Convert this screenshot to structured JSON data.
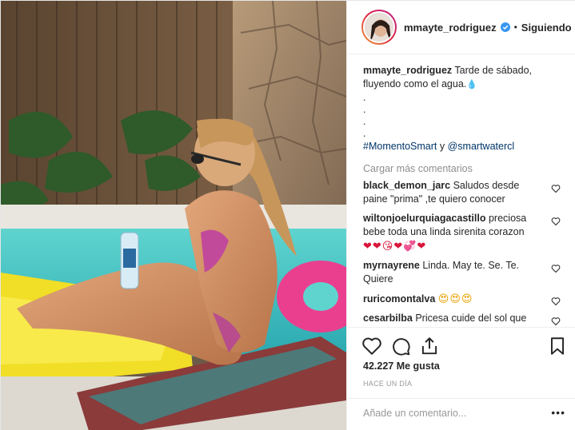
{
  "header": {
    "username": "mmayte_rodriguez",
    "separator": "•",
    "follow_label": "Siguiendo"
  },
  "caption": {
    "username": "mmayte_rodriguez",
    "text": "Tarde de sábado, fluyendo como el agua.",
    "droplet": "💧",
    "dots": [
      ".",
      ".",
      ".",
      "."
    ],
    "hashtag": "#MomentoSmart",
    "conjunction": " y ",
    "mention": "@smartwatercl"
  },
  "load_more_label": "Cargar más comentarios",
  "comments": [
    {
      "username": "black_demon_jarc",
      "text": "Saludos desde paine \"prima\" ,te quiero conocer",
      "emoji": ""
    },
    {
      "username": "wiltonjoelurquiagacastillo",
      "text": "preciosa bebe toda una linda sirenita corazon",
      "emoji": "❤❤😘❤💞❤"
    },
    {
      "username": "myrnayrene",
      "text": "Linda. May te. Se. Te. Quiere",
      "emoji": ""
    },
    {
      "username": "ruricomontalva",
      "text": "",
      "emoji": "😍😍😍"
    },
    {
      "username": "cesarbilba",
      "text": "Pricesa cuide del sol que esta quemando muy fuerte Bendicion",
      "emoji": ""
    }
  ],
  "likes_label": "42.227 Me gusta",
  "time_label": "HACE UN DÍA",
  "add_comment": {
    "placeholder": "Añade un comentario..."
  },
  "more_label": "•••",
  "icons": {
    "like": "heart-icon",
    "comment": "comment-icon",
    "share": "share-icon",
    "save": "bookmark-icon",
    "verified": "verified-badge-icon",
    "comment_like": "heart-icon"
  },
  "colors": {
    "accent_blue": "#3897f0",
    "hashtag": "#003569",
    "muted": "#8e8e8e",
    "text": "#262626"
  }
}
